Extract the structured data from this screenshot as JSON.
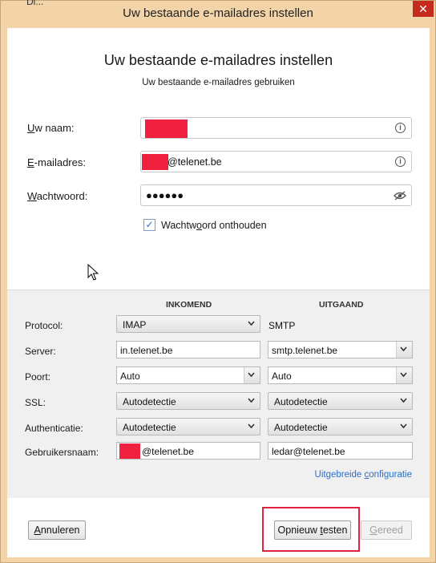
{
  "window": {
    "title": "Uw bestaande e-mailadres instellen",
    "close_glyph": "✕",
    "behind_text": "Di..."
  },
  "header": {
    "title": "Uw bestaande e-mailadres instellen",
    "subtitle": "Uw bestaande e-mailadres gebruiken"
  },
  "form": {
    "name_label_u": "U",
    "name_label_rest": "w naam:",
    "name_value": "",
    "email_label_u": "E",
    "email_label_rest": "-mailadres:",
    "email_value": "@telenet.be",
    "password_label_u": "W",
    "password_label_rest": "achtwoord:",
    "password_value": "●●●●●●",
    "remember_label_pre": "Wachtw",
    "remember_label_u": "o",
    "remember_label_post": "ord onthouden",
    "remember_checked": true,
    "checkmark": "✓"
  },
  "config": {
    "incoming_header": "INKOMEND",
    "outgoing_header": "UITGAAND",
    "rows": {
      "protocol": {
        "label": "Protocol:",
        "incoming": "IMAP",
        "outgoing": "SMTP"
      },
      "server": {
        "label": "Server:",
        "incoming": "in.telenet.be",
        "outgoing": "smtp.telenet.be"
      },
      "port": {
        "label": "Poort:",
        "incoming": "Auto",
        "outgoing": "Auto"
      },
      "ssl": {
        "label": "SSL:",
        "incoming": "Autodetectie",
        "outgoing": "Autodetectie"
      },
      "auth": {
        "label": "Authenticatie:",
        "incoming": "Autodetectie",
        "outgoing": "Autodetectie"
      },
      "username": {
        "label": "Gebruikersnaam:",
        "incoming": "@telenet.be",
        "outgoing": "ledar@telenet.be"
      }
    },
    "advanced_link_pre": "Uitgebreide ",
    "advanced_link_u": "c",
    "advanced_link_post": "onfiguratie"
  },
  "footer": {
    "cancel_u": "A",
    "cancel_rest": "nnuleren",
    "retest_pre": "Opnieuw ",
    "retest_u": "t",
    "retest_post": "esten",
    "done_u": "G",
    "done_rest": "ereed"
  },
  "colors": {
    "redaction": "#f0213f",
    "highlight": "#e0233f",
    "link": "#2a6fc9",
    "titlebar": "#f3d4a8"
  }
}
